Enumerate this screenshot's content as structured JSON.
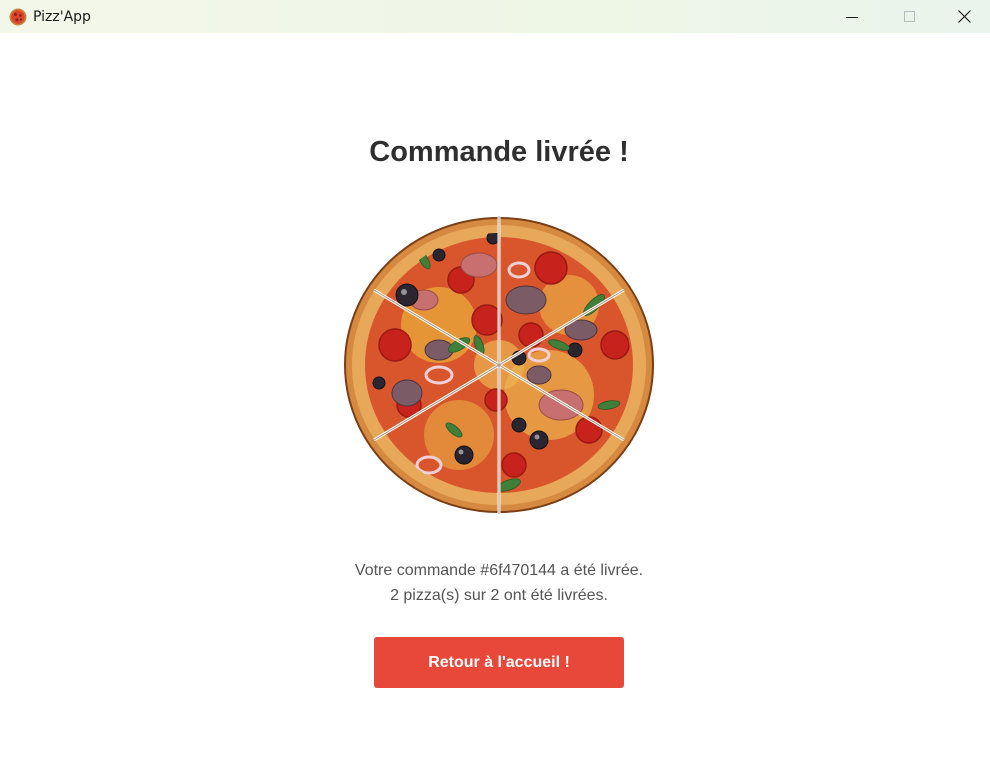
{
  "window": {
    "title": "Pizz'App",
    "controls": {
      "minimize": "minimize-icon",
      "maximize": "maximize-icon",
      "close": "close-icon"
    }
  },
  "main": {
    "heading": "Commande livrée !",
    "message_line1": "Votre commande #6f470144 a été livrée.",
    "message_line2": "2 pizza(s) sur 2 ont été livrées.",
    "button_label": "Retour à l'accueil !"
  },
  "colors": {
    "accent": "#e8483a",
    "heading": "#2f2f2f",
    "text": "#555555"
  }
}
